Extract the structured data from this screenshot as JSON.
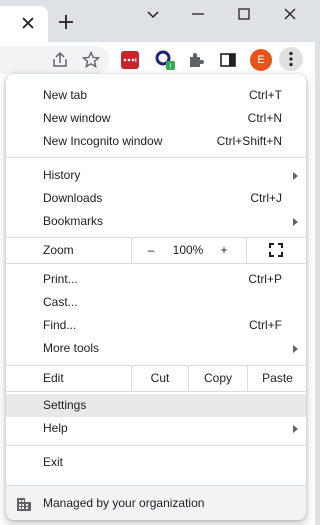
{
  "menu": {
    "group1": [
      {
        "label": "New tab",
        "shortcut": "Ctrl+T"
      },
      {
        "label": "New window",
        "shortcut": "Ctrl+N"
      },
      {
        "label": "New Incognito window",
        "shortcut": "Ctrl+Shift+N"
      }
    ],
    "group2": [
      {
        "label": "History",
        "shortcut": ""
      },
      {
        "label": "Downloads",
        "shortcut": "Ctrl+J"
      },
      {
        "label": "Bookmarks",
        "shortcut": ""
      }
    ],
    "zoom": {
      "label": "Zoom",
      "minus": "–",
      "value": "100%",
      "plus": "+"
    },
    "group3": [
      {
        "label": "Print...",
        "shortcut": "Ctrl+P"
      },
      {
        "label": "Cast...",
        "shortcut": ""
      },
      {
        "label": "Find...",
        "shortcut": "Ctrl+F"
      },
      {
        "label": "More tools",
        "shortcut": ""
      }
    ],
    "edit": {
      "label": "Edit",
      "cut": "Cut",
      "copy": "Copy",
      "paste": "Paste"
    },
    "group4": [
      {
        "label": "Settings",
        "shortcut": ""
      },
      {
        "label": "Help",
        "shortcut": ""
      }
    ],
    "exit": {
      "label": "Exit"
    },
    "managed": {
      "label": "Managed by your organization"
    }
  },
  "toolbar": {
    "avatar_letter": "E",
    "icons": [
      "share-icon",
      "star-icon",
      "lastpass-extension-icon",
      "extension-icon",
      "puzzle-icon",
      "side-panel-icon",
      "profile-avatar",
      "kebab-menu-icon"
    ]
  },
  "colors": {
    "avatar": "#e8541c",
    "lastpass": "#c9242c",
    "highlight": "#e8e8e8"
  }
}
